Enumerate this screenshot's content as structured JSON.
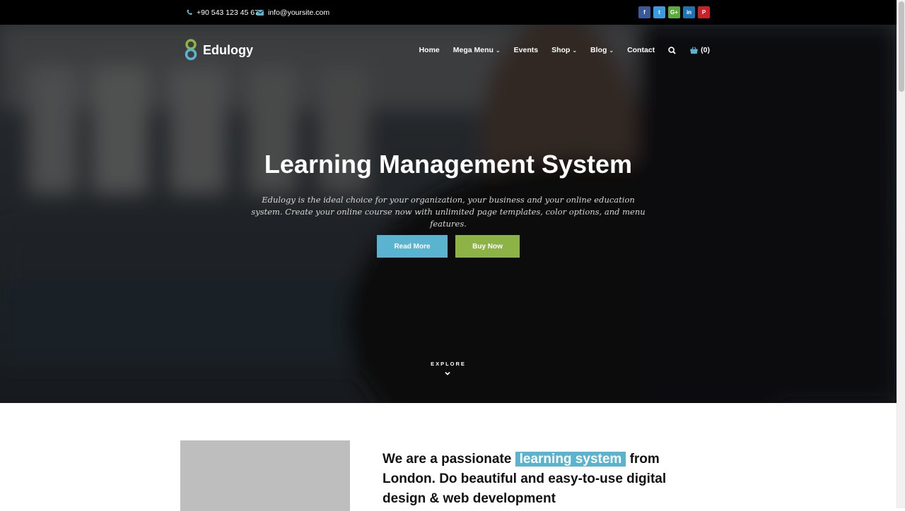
{
  "topbar": {
    "phone": "+90 543 123 45 67",
    "email": "info@yoursite.com",
    "social": [
      {
        "icon": "facebook-icon",
        "glyph": "f",
        "color": "#3b5998"
      },
      {
        "icon": "twitter-icon",
        "glyph": "t",
        "color": "#3b9ae0"
      },
      {
        "icon": "google-plus-icon",
        "glyph": "G+",
        "color": "#5cab3c"
      },
      {
        "icon": "linkedin-icon",
        "glyph": "in",
        "color": "#1d74b2"
      },
      {
        "icon": "pinterest-icon",
        "glyph": "P",
        "color": "#cb2027"
      }
    ]
  },
  "brand": {
    "name": "Edulogy"
  },
  "menu": {
    "home": "Home",
    "mega": "Mega Menu",
    "events": "Events",
    "shop": "Shop",
    "blog": "Blog",
    "contact": "Contact",
    "cart": "(0)"
  },
  "hero": {
    "title": "Learning Management System",
    "description": "Edulogy is the ideal choice for your organization, your business and your online education system. Create your online course now with unlimited page templates, color options, and menu features.",
    "read_more": "Read More",
    "buy_now": "Buy Now",
    "explore": "EXPLORE"
  },
  "about": {
    "lead": "We are a passionate ",
    "highlight": "learning system",
    "rest": " from London. Do beautiful and easy-to-use digital design & web development"
  },
  "colors": {
    "accent_blue": "#5ab4d0",
    "accent_green": "#8db346",
    "topbar": "#000000"
  }
}
